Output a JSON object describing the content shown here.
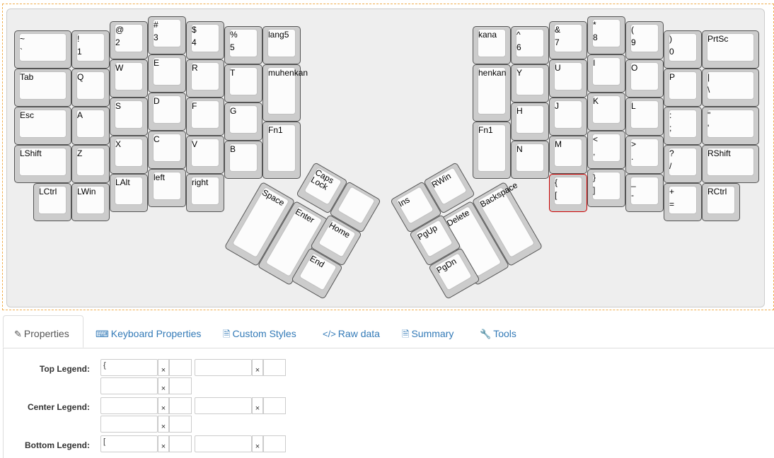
{
  "keys": {
    "grave": {
      "top": "~",
      "bottom": "`"
    },
    "k1": {
      "top": "!",
      "bottom": "1"
    },
    "k2": {
      "top": "@",
      "bottom": "2"
    },
    "k3": {
      "top": "#",
      "bottom": "3"
    },
    "k4": {
      "top": "$",
      "bottom": "4"
    },
    "k5": {
      "top": "%",
      "bottom": "5"
    },
    "lang5": {
      "top": "lang5"
    },
    "tab": {
      "top": "Tab"
    },
    "q": {
      "top": "Q"
    },
    "w": {
      "top": "W"
    },
    "e": {
      "top": "E"
    },
    "r": {
      "top": "R"
    },
    "t": {
      "top": "T"
    },
    "muhenkan": {
      "top": "muhenkan"
    },
    "esc": {
      "top": "Esc"
    },
    "a": {
      "top": "A"
    },
    "s": {
      "top": "S"
    },
    "d": {
      "top": "D"
    },
    "f": {
      "top": "F"
    },
    "g": {
      "top": "G"
    },
    "fn1_left": {
      "top": "Fn1"
    },
    "lshift": {
      "top": "LShift"
    },
    "z": {
      "top": "Z"
    },
    "x": {
      "top": "X"
    },
    "c": {
      "top": "C"
    },
    "v": {
      "top": "V"
    },
    "b": {
      "top": "B"
    },
    "lctrl": {
      "top": "LCtrl"
    },
    "lwin": {
      "top": "LWin"
    },
    "lalt": {
      "top": "LAlt"
    },
    "left": {
      "top": "left"
    },
    "right": {
      "top": "right"
    },
    "kana": {
      "top": "kana"
    },
    "k6": {
      "top": "^",
      "bottom": "6"
    },
    "k7": {
      "top": "&",
      "bottom": "7"
    },
    "k8": {
      "top": "*",
      "bottom": "8"
    },
    "k9": {
      "top": "(",
      "bottom": "9"
    },
    "k0": {
      "top": ")",
      "bottom": "0"
    },
    "prtsc": {
      "top": "PrtSc"
    },
    "henkan": {
      "top": "henkan"
    },
    "y": {
      "top": "Y"
    },
    "u": {
      "top": "U"
    },
    "i": {
      "top": "I"
    },
    "o": {
      "top": "O"
    },
    "p": {
      "top": "P"
    },
    "pipe": {
      "top": "|",
      "bottom": "\\"
    },
    "fn1_right": {
      "top": "Fn1"
    },
    "h": {
      "top": "H"
    },
    "j": {
      "top": "J"
    },
    "k": {
      "top": "K"
    },
    "l": {
      "top": "L"
    },
    "semicolon": {
      "top": ":",
      "bottom": ";"
    },
    "quote": {
      "top": "\"",
      "bottom": "'"
    },
    "n": {
      "top": "N"
    },
    "m": {
      "top": "M"
    },
    "comma": {
      "top": "<",
      "bottom": ","
    },
    "period": {
      "top": ">",
      "bottom": "."
    },
    "slash": {
      "top": "?",
      "bottom": "/"
    },
    "rshift": {
      "top": "RShift"
    },
    "lbracket": {
      "top": "{",
      "bottom": "["
    },
    "rbracket": {
      "top": "}",
      "bottom": "]"
    },
    "minus": {
      "top": "_",
      "bottom": "-"
    },
    "equals": {
      "top": "+",
      "bottom": "="
    },
    "rctrl": {
      "top": "RCtrl"
    },
    "capslock": {
      "top": "Caps Lock"
    },
    "space": {
      "top": "Space"
    },
    "enter": {
      "top": "Enter"
    },
    "home": {
      "top": "Home"
    },
    "end": {
      "top": "End"
    },
    "rwin": {
      "top": "RWin"
    },
    "ins": {
      "top": "Ins"
    },
    "delete": {
      "top": "Delete"
    },
    "backspace": {
      "top": "Backspace"
    },
    "pgup": {
      "top": "PgUp"
    },
    "pgdn": {
      "top": "PgDn"
    },
    "blank": {
      "top": ""
    }
  },
  "tabs": [
    {
      "label": "Properties",
      "icon": "pencil-square-icon"
    },
    {
      "label": "Keyboard Properties",
      "icon": "keyboard-icon"
    },
    {
      "label": "Custom Styles",
      "icon": "file-text-icon"
    },
    {
      "label": "Raw data",
      "icon": "code-icon"
    },
    {
      "label": "Summary",
      "icon": "file-text-icon"
    },
    {
      "label": "Tools",
      "icon": "wrench-icon"
    }
  ],
  "properties": {
    "top_legend_label": "Top Legend:",
    "center_legend_label": "Center Legend:",
    "bottom_legend_label": "Bottom Legend:",
    "top_left_value": "{",
    "bottom_left_value": "[",
    "clear_glyph": "×"
  },
  "colors": {
    "selected_key_border": "#cc0000",
    "tab_link": "#337ab7",
    "editor_border": "#f0ad4e"
  }
}
